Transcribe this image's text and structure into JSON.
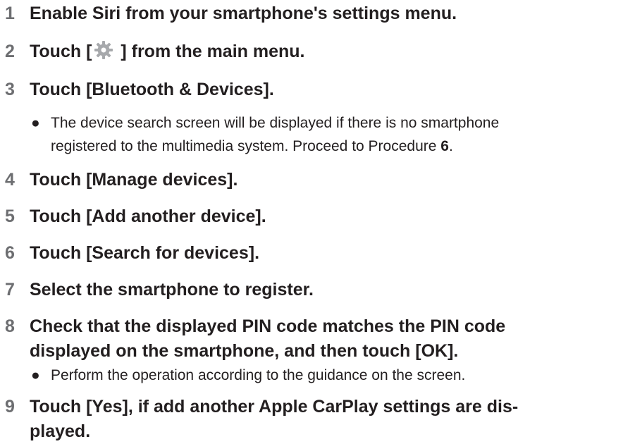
{
  "steps": [
    {
      "num": "1",
      "text": "Enable Siri from your smartphone's settings menu."
    },
    {
      "num": "2",
      "text_before": "Touch [",
      "text_after": " ] from the main menu.",
      "icon": "gear-icon"
    },
    {
      "num": "3",
      "text": "Touch [Bluetooth & Devices]."
    },
    {
      "num": "4",
      "text": "Touch [Manage devices]."
    },
    {
      "num": "5",
      "text": "Touch [Add another device]."
    },
    {
      "num": "6",
      "text": "Touch [Search for devices]."
    },
    {
      "num": "7",
      "text": "Select the smartphone to register."
    },
    {
      "num": "8",
      "line1": "Check that the displayed PIN code matches the PIN code",
      "line2": "displayed on the smartphone, and then touch [OK]."
    },
    {
      "num": "9",
      "line1": "Touch [Yes], if add another Apple CarPlay settings are dis-",
      "line2": "played."
    }
  ],
  "notes": {
    "step3": {
      "bullet": "●",
      "line1": "The device search screen will be displayed if there is no smartphone",
      "line2_before": "registered to the multimedia system. Proceed to Procedure ",
      "line2_bold": "6",
      "line2_after": "."
    },
    "step8": {
      "bullet": "●",
      "line1": "Perform the operation according to the guidance on the screen."
    }
  },
  "colors": {
    "step_number": "#6d6e71",
    "text": "#231f20",
    "gear_icon": "#a7a9ac"
  }
}
